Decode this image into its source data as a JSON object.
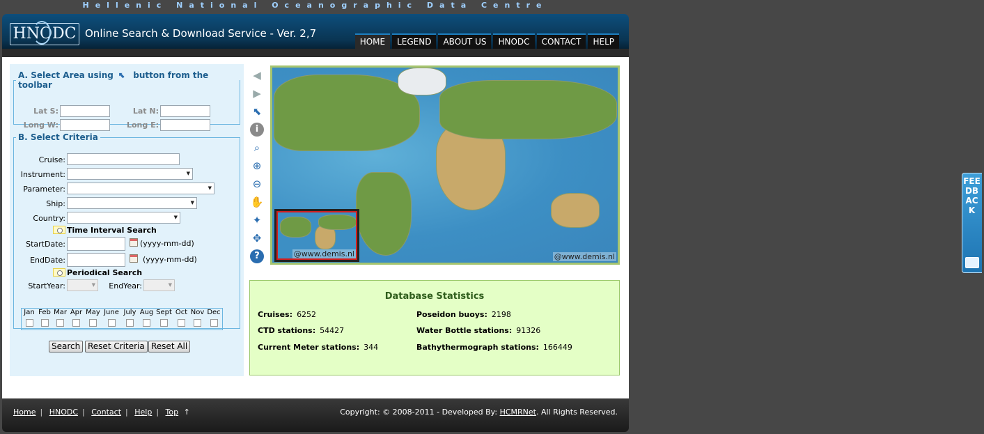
{
  "top_banner": "Hellenic National Oceanographic Data Centre",
  "header": {
    "logo_text": "HNODC",
    "service_title": "Online Search & Download Service - Ver. 2,7"
  },
  "nav": [
    "HOME",
    "LEGEND",
    "ABOUT US",
    "HNODC",
    "CONTACT",
    "HELP"
  ],
  "area": {
    "legend_before": "A. Select Area using",
    "legend_after": "button from the toolbar",
    "lat_s": "Lat S:",
    "lat_n": "Lat N:",
    "long_w": "Long W:",
    "long_e": "Long E:"
  },
  "criteria": {
    "legend": "B. Select Criteria",
    "cruise": "Cruise:",
    "instrument": "Instrument:",
    "parameter": "Parameter:",
    "ship": "Ship:",
    "country": "Country:",
    "time_interval": "Time Interval Search",
    "start_date": "StartDate:",
    "end_date": "EndDate:",
    "date_hint": "(yyyy-mm-dd)",
    "periodical": "Periodical Search",
    "start_year": "StartYear:",
    "end_year": "EndYear:",
    "months": [
      "Jan",
      "Feb",
      "Mar",
      "Apr",
      "May",
      "June",
      "July",
      "Aug",
      "Sept",
      "Oct",
      "Nov",
      "Dec"
    ]
  },
  "buttons": {
    "search": "Search",
    "reset_criteria": "Reset Criteria",
    "reset_all": "Reset All"
  },
  "map": {
    "credit": "@www.demis.nl"
  },
  "stats": {
    "title": "Database Statistics",
    "items": [
      {
        "label": "Cruises:",
        "value": "6252"
      },
      {
        "label": "Poseidon buoys:",
        "value": "2198"
      },
      {
        "label": "CTD stations:",
        "value": "54427"
      },
      {
        "label": "Water Bottle stations:",
        "value": "91326"
      },
      {
        "label": "Current Meter stations:",
        "value": "344"
      },
      {
        "label": "Bathythermograph stations:",
        "value": "166449"
      }
    ]
  },
  "footer": {
    "links": [
      "Home",
      "HNODC",
      "Contact",
      "Help",
      "Top"
    ],
    "top_arrow": "↑",
    "copyright_before": "Copyright: © 2008-2011 - Developed By:",
    "developer": "HCMRNet",
    "copyright_after": ". All Rights Reserved."
  },
  "feedback": "FEEDBACK",
  "colors": {
    "header": "#0a3553",
    "accent": "#1d7fc0",
    "stats_bg": "#e4ffc6",
    "panel_bg": "#e2f2fb"
  }
}
